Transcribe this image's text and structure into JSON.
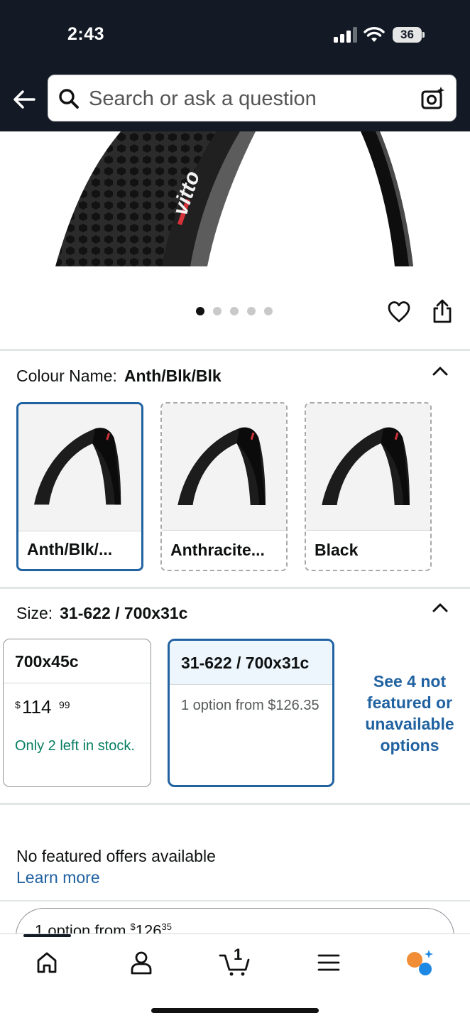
{
  "status_bar": {
    "time": "2:43",
    "battery": "36"
  },
  "search": {
    "placeholder": "Search or ask a question"
  },
  "gallery": {
    "dot_count": 5,
    "active_index": 0
  },
  "colour": {
    "label": "Colour Name:",
    "selected_value": "Anth/Blk/Blk",
    "options": [
      {
        "label": "Anth/Blk/...",
        "state": "selected"
      },
      {
        "label": "Anthracite...",
        "state": "unavailable"
      },
      {
        "label": "Black",
        "state": "unavailable"
      }
    ]
  },
  "size": {
    "label": "Size:",
    "selected_value": "31-622 / 700x31c",
    "options": [
      {
        "label": "700x45c",
        "price_symbol": "$",
        "price_whole": "114",
        "price_fraction": "99",
        "stock": "Only 2 left in stock."
      },
      {
        "label": "31-622 / 700x31c",
        "option_from": "1 option from $126.35"
      }
    ],
    "see_more": "See 4 not featured or unavailable options"
  },
  "offers": {
    "no_offers": "No featured offers available",
    "learn_more": "Learn more",
    "pill_prefix": "1 option from ",
    "pill_symbol": "$",
    "pill_whole": "126",
    "pill_fraction": "35"
  },
  "bottom_nav": {
    "cart_count": "1",
    "icons": [
      "home-icon",
      "account-icon",
      "cart-icon",
      "menu-icon",
      "rufus-icon"
    ]
  },
  "colors": {
    "header_bg": "#131a26",
    "link": "#2162a1",
    "stock_green": "#067d62",
    "selected_border": "#2162a1"
  }
}
